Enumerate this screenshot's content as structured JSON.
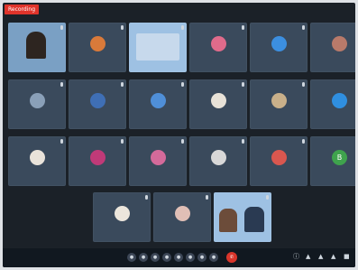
{
  "window": {
    "recording_badge": "Recording"
  },
  "colors": {
    "recording": "#e0342b",
    "tile_bg": "#3a4a5c",
    "end_call": "#d9352b"
  },
  "participants": [
    {
      "name": "",
      "type": "video",
      "icon": "person-video"
    },
    {
      "name": "",
      "type": "avatar-photo",
      "icon": "user-avatar-icon"
    },
    {
      "name": "",
      "type": "video",
      "icon": "shared-video"
    },
    {
      "name": "",
      "type": "avatar-photo",
      "icon": "user-avatar-icon"
    },
    {
      "name": "",
      "type": "avatar",
      "icon": "user-avatar-icon"
    },
    {
      "name": "",
      "type": "avatar-photo",
      "icon": "user-avatar-icon"
    },
    {
      "name": "",
      "type": "avatar",
      "icon": "user-avatar-icon"
    },
    {
      "name": "",
      "type": "avatar",
      "icon": "user-avatar-icon"
    },
    {
      "name": "",
      "type": "avatar",
      "icon": "user-avatar-icon"
    },
    {
      "name": "",
      "type": "avatar-photo",
      "icon": "user-avatar-icon"
    },
    {
      "name": "",
      "type": "avatar-photo",
      "icon": "user-avatar-icon"
    },
    {
      "name": "",
      "type": "avatar",
      "icon": "user-avatar-icon"
    },
    {
      "name": "",
      "type": "avatar-photo",
      "icon": "user-avatar-icon"
    },
    {
      "name": "",
      "type": "avatar",
      "icon": "user-avatar-icon"
    },
    {
      "name": "",
      "type": "avatar",
      "icon": "user-avatar-icon"
    },
    {
      "name": "",
      "type": "avatar-photo",
      "icon": "user-avatar-icon"
    },
    {
      "name": "",
      "type": "avatar",
      "icon": "user-avatar-icon"
    },
    {
      "name": "",
      "type": "avatar",
      "initial": "B",
      "icon": "user-avatar-icon"
    },
    {
      "name": "",
      "type": "avatar-photo",
      "icon": "user-avatar-icon"
    },
    {
      "name": "",
      "type": "avatar-photo",
      "icon": "user-avatar-icon"
    },
    {
      "name": "",
      "type": "video",
      "icon": "person-video"
    }
  ],
  "toolbar": {
    "meeting_title": "",
    "controls": [
      "mic-icon",
      "camera-icon",
      "share-icon",
      "participants-icon",
      "chat-icon",
      "raise-hand-icon",
      "more-icon"
    ],
    "end_call_label": ""
  }
}
